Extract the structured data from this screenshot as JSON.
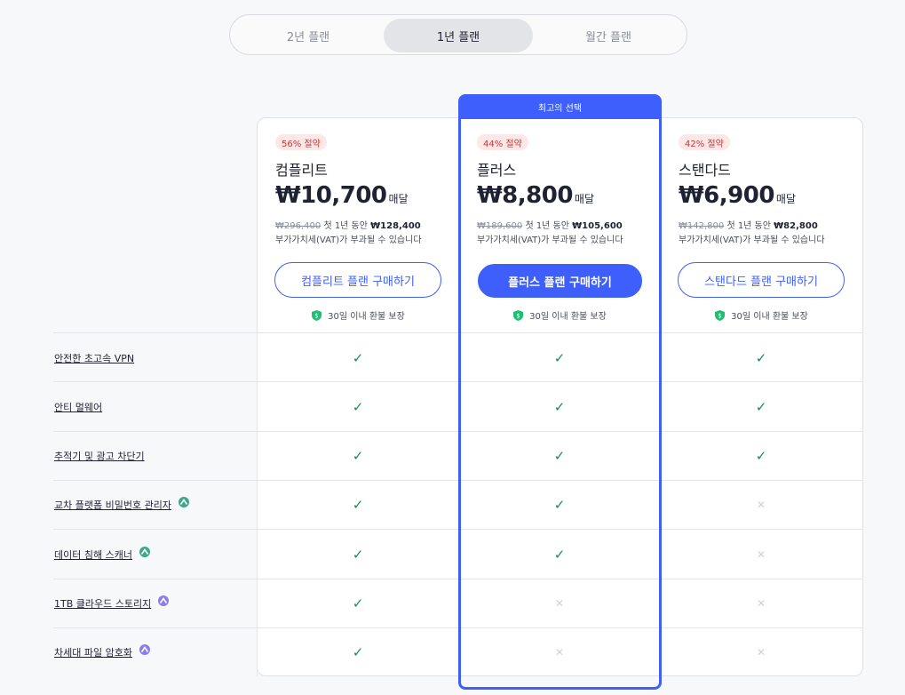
{
  "billing_toggle": {
    "options": [
      "2년 플랜",
      "1년 플랜",
      "월간 플랜"
    ],
    "selected_index": 1
  },
  "best_choice_label": "최고의 선택",
  "plans": [
    {
      "badge": "56% 절약",
      "name": "컴플리트",
      "price": "₩10,700",
      "price_unit": "매달",
      "original_price": "₩296,400",
      "first_year_text": "첫 1년 동안",
      "first_year_price": "₩128,400",
      "vat_note": "부가가치세(VAT)가 부과될 수 있습니다",
      "buy_label": "컴플리트 플랜 구매하기",
      "primary": false,
      "guarantee": "30일 이내 환불 보장"
    },
    {
      "badge": "44% 절약",
      "name": "플러스",
      "price": "₩8,800",
      "price_unit": "매달",
      "original_price": "₩189,600",
      "first_year_text": "첫 1년 동안",
      "first_year_price": "₩105,600",
      "vat_note": "부가가치세(VAT)가 부과될 수 있습니다",
      "buy_label": "플러스 플랜 구매하기",
      "primary": true,
      "guarantee": "30일 이내 환불 보장"
    },
    {
      "badge": "42% 절약",
      "name": "스탠다드",
      "price": "₩6,900",
      "price_unit": "매달",
      "original_price": "₩142,800",
      "first_year_text": "첫 1년 동안",
      "first_year_price": "₩82,800",
      "vat_note": "부가가치세(VAT)가 부과될 수 있습니다",
      "buy_label": "스탠다드 플랜 구매하기",
      "primary": false,
      "guarantee": "30일 이내 환불 보장"
    }
  ],
  "features": [
    {
      "label": "안전한 초고속 VPN",
      "icon": null,
      "availability": [
        true,
        true,
        true
      ]
    },
    {
      "label": "안티 멀웨어",
      "icon": null,
      "availability": [
        true,
        true,
        true
      ]
    },
    {
      "label": "추적기 및 광고 차단기",
      "icon": null,
      "availability": [
        true,
        true,
        true
      ]
    },
    {
      "label": "교차 플랫폼 비밀번호 관리자",
      "icon": "password-manager-icon",
      "availability": [
        true,
        true,
        false
      ]
    },
    {
      "label": "데이터 침해 스캐너",
      "icon": "password-manager-icon",
      "availability": [
        true,
        true,
        false
      ]
    },
    {
      "label": "1TB 클라우드 스토리지",
      "icon": "cloud-storage-icon",
      "availability": [
        true,
        false,
        false
      ]
    },
    {
      "label": "차세대 파일 암호화",
      "icon": "cloud-storage-icon",
      "availability": [
        true,
        false,
        false
      ]
    }
  ],
  "colors": {
    "accent": "#3e5ffb",
    "check": "#1d8a57",
    "cross": "#cfd1d6",
    "badge_bg": "#fde7e7",
    "badge_text": "#c13a3a",
    "shield": "#1fbf72",
    "pm_icon": "#3ea88a",
    "cloud_icon": "#8b7cf0"
  }
}
